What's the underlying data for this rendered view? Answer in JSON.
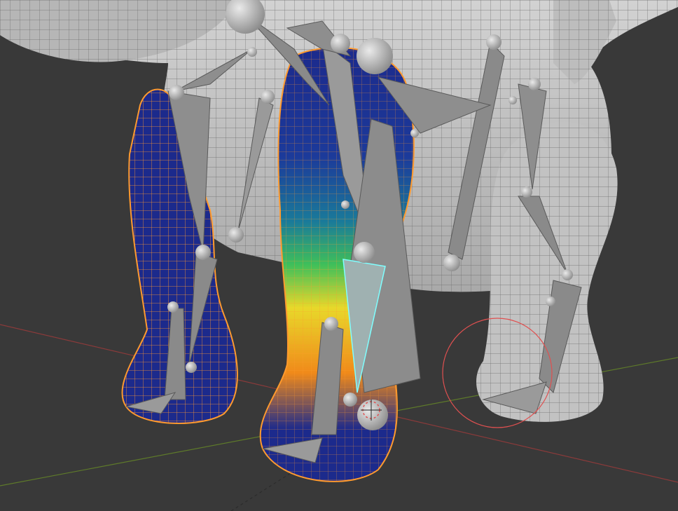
{
  "viewport": {
    "mode": "Weight Paint",
    "background_color": "#393939",
    "grid_line_color": "#2f2f2f"
  },
  "axes": {
    "x_axis_color": "#8a3a3a",
    "y_axis_color": "#5e7a2a"
  },
  "mesh": {
    "surface_color": "#c4c4c4",
    "wire_color": "#6a6a6a",
    "selected_outline_color": "#ff9a2e"
  },
  "weight_gradient": {
    "low": "#1c2a8c",
    "mid_low": "#1a7a9a",
    "mid": "#3fbf5a",
    "mid_high": "#e8d82a",
    "high": "#f08a1a"
  },
  "armature": {
    "bone_color": "#8a8a8a",
    "joint_color": "#bdbdbd",
    "active_bone_outline": "#7fffff"
  },
  "brush_cursor": {
    "color": "#e05050"
  },
  "header_highlight": {
    "color": "#4a72b8"
  }
}
